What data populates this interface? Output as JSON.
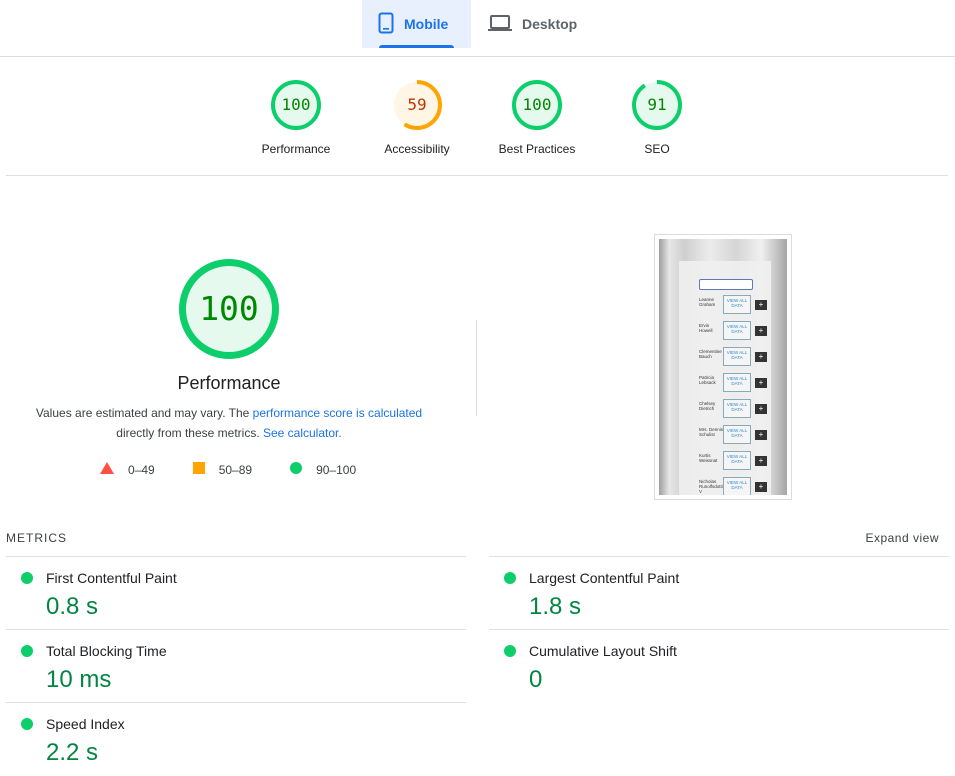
{
  "tabs": [
    {
      "label": "Mobile",
      "icon": "phone-icon",
      "active": true
    },
    {
      "label": "Desktop",
      "icon": "laptop-icon",
      "active": false
    }
  ],
  "scores": [
    {
      "value": "100",
      "score": 100,
      "label": "Performance",
      "status": "pass"
    },
    {
      "value": "59",
      "score": 59,
      "label": "Accessibility",
      "status": "average"
    },
    {
      "value": "100",
      "score": 100,
      "label": "Best Practices",
      "status": "pass"
    },
    {
      "value": "91",
      "score": 91,
      "label": "SEO",
      "status": "pass"
    }
  ],
  "performance": {
    "score": "100",
    "title": "Performance",
    "desc_prefix": "Values are estimated and may vary. The ",
    "desc_link1": "performance score is calculated",
    "desc_middle": "directly from these metrics. ",
    "desc_link2": "See calculator."
  },
  "legend": [
    {
      "range": "0–49",
      "shape": "triangle",
      "color": "#ff4e42"
    },
    {
      "range": "50–89",
      "shape": "square",
      "color": "#ffa400"
    },
    {
      "range": "90–100",
      "shape": "circle",
      "color": "#0cce6b"
    }
  ],
  "thumbnail": {
    "view_label": "VIEW ALL DATA",
    "add_label": "+",
    "rows": [
      "Leanne Graham",
      "Ervin Howell",
      "Clementine Bauch",
      "Patricia Lebsack",
      "Chelsey Dietrich",
      "Mrs. Dennis Schulist",
      "Kurtis Weissnat",
      "Nicholas Runolfsdottir V"
    ]
  },
  "metrics": {
    "heading": "METRICS",
    "expand": "Expand view",
    "items": [
      {
        "title": "First Contentful Paint",
        "value": "0.8 s"
      },
      {
        "title": "Largest Contentful Paint",
        "value": "1.8 s"
      },
      {
        "title": "Total Blocking Time",
        "value": "10 ms"
      },
      {
        "title": "Cumulative Layout Shift",
        "value": "0"
      },
      {
        "title": "Speed Index",
        "value": "2.2 s"
      }
    ]
  },
  "colors": {
    "pass": "#0cce6b",
    "pass_text": "#008800",
    "average": "#ffa400",
    "average_text": "#c33300",
    "link": "#1a73e8"
  }
}
